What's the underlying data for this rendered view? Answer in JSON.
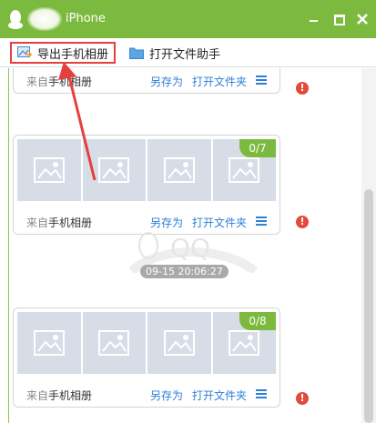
{
  "window": {
    "title": "iPhone",
    "accent_color": "#7cba3f"
  },
  "toolbar": {
    "export_label": "导出手机相册",
    "open_assistant_label": "打开文件助手"
  },
  "cards": [
    {
      "source_prefix": "来自",
      "source_name": "手机相册",
      "save_as": "另存为",
      "open_folder": "打开文件夹"
    },
    {
      "count": "0/7",
      "source_prefix": "来自",
      "source_name": "手机相册",
      "save_as": "另存为",
      "open_folder": "打开文件夹"
    },
    {
      "count": "0/8",
      "source_prefix": "来自",
      "source_name": "手机相册",
      "save_as": "另存为",
      "open_folder": "打开文件夹"
    }
  ],
  "timestamp": "09-15 20:06:27",
  "watermark_text": "QQ",
  "warning_symbol": "!"
}
